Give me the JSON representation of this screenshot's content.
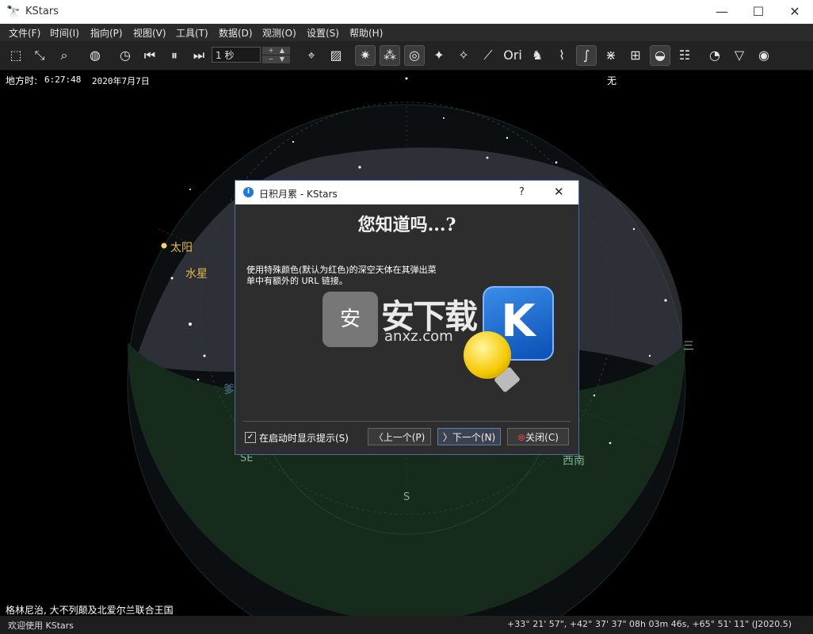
{
  "window": {
    "title": "KStars",
    "minimize": "—",
    "maximize": "☐",
    "close": "✕"
  },
  "menu": [
    "文件(F)",
    "时间(I)",
    "指向(P)",
    "视图(V)",
    "工具(T)",
    "数据(D)",
    "观测(O)",
    "设置(S)",
    "帮助(H)"
  ],
  "toolbar": {
    "time_step": "1 秒"
  },
  "sky": {
    "local_time_label": "地方时:",
    "local_time": "6:27:48",
    "date": "2020年7月7日",
    "top_right": "无",
    "sun": "太阳",
    "mercury": "水星",
    "east_partial": "三",
    "southeast": "SE",
    "south": "S",
    "southwest": "西南",
    "left_partial": "爹"
  },
  "location": "格林尼治, 大不列颠及北爱尔兰联合王国",
  "status": {
    "message": "欢迎使用 KStars",
    "coords": "+33° 21' 57\", +42° 37' 37\"  08h 03m 46s, +65° 51' 11\" (J2020.5)"
  },
  "dialog": {
    "title": "日积月累 - KStars",
    "help": "?",
    "close": "✕",
    "heading": "您知道吗...?",
    "body": "使用特殊颜色(默认为红色)的深空天体在其弹出菜单中有额外的 URL 链接。",
    "show_on_startup": "在启动时显示提示(S)",
    "show_on_startup_checked": true,
    "prev": "上一个(P)",
    "next": "下一个(N)",
    "close_btn": "关闭(C)"
  },
  "watermark": {
    "main": "安下载",
    "sub": "anxz.com",
    "badge": "安"
  },
  "colors": {
    "sun_label": "#e6b94a",
    "horizon": "#1a3a24",
    "sky": "#000000",
    "dialog_border": "#4a6fa5"
  }
}
